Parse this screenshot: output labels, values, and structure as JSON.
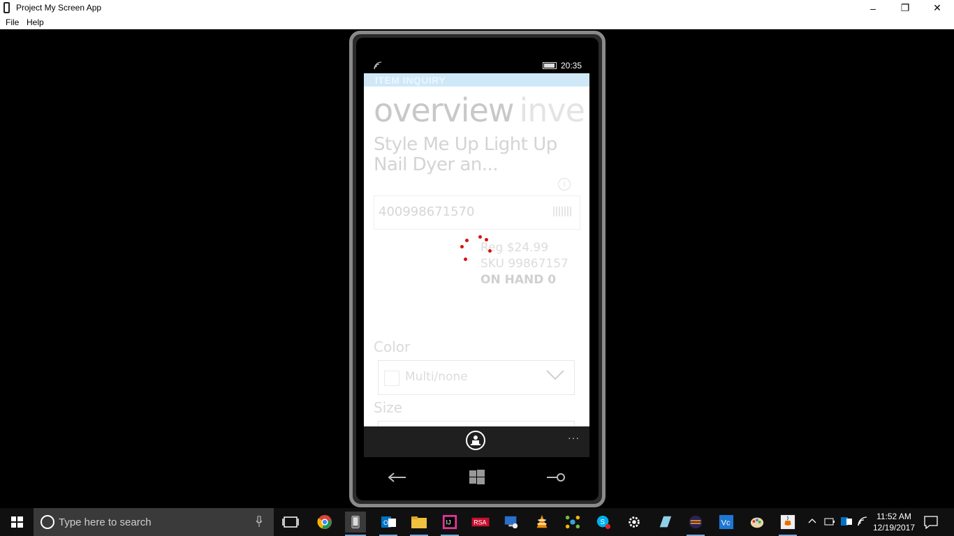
{
  "window": {
    "title": "Project My Screen App",
    "controls": {
      "minimize": "–",
      "maximize": "❐",
      "close": "✕"
    }
  },
  "menu": {
    "file": "File",
    "help": "Help"
  },
  "phone": {
    "status": {
      "time": "20:35"
    },
    "app_title": "ITEM INQUIRY",
    "pivot": {
      "active": "overview",
      "next": "inve"
    },
    "product_name": "Style Me Up Light Up Nail Dyer an...",
    "info_icon": "i",
    "sku_input": "400998671570",
    "price": {
      "reg": "Reg $24.99",
      "sku": "SKU 99867157",
      "on_hand": "ON HAND 0"
    },
    "color": {
      "label": "Color",
      "value": "Multi/none"
    },
    "size": {
      "label": "Size"
    },
    "appbar": {
      "more": "···"
    }
  },
  "taskbar": {
    "search_placeholder": "Type here to search",
    "clock_time": "11:52 AM",
    "clock_date": "12/19/2017",
    "apps": [
      "task-view",
      "chrome",
      "project-my-screen",
      "outlook",
      "file-explorer",
      "intellij",
      "rsa",
      "remote-desktop",
      "vlc",
      "network-app",
      "skype",
      "settings",
      "book-app",
      "eclipse",
      "visual-code",
      "paint",
      "java"
    ]
  },
  "colors": {
    "spinner": "#d8130a",
    "app_header": "#cfe8f7",
    "taskbar": "#101010"
  }
}
